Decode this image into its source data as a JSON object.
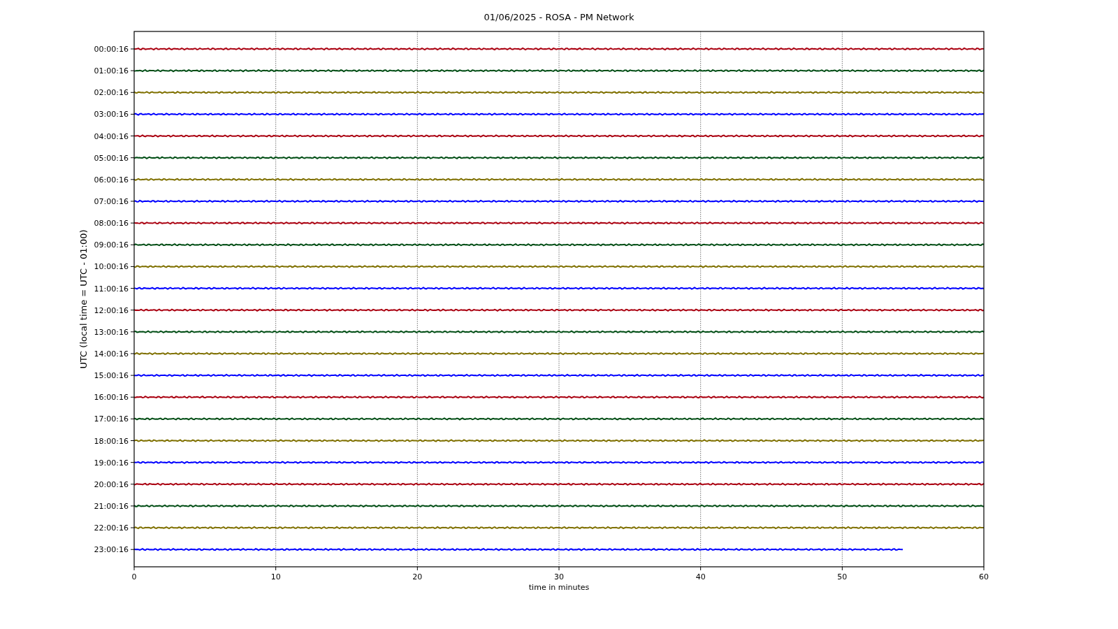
{
  "title": "01/06/2025 - ROSA - PM Network",
  "y_axis_label": "UTC (local time = UTC - 01:00)",
  "x_axis_label": "time in minutes",
  "x_ticks": [
    "0",
    "10",
    "20",
    "30",
    "40",
    "50",
    "60"
  ],
  "traces": [
    {
      "label": "00:00:16",
      "color": "#aa0010",
      "level": 1
    },
    {
      "label": "01:00:16",
      "color": "#004d14",
      "level": 1
    },
    {
      "label": "02:00:16",
      "color": "#7f7000",
      "level": 1
    },
    {
      "label": "03:00:16",
      "color": "#0000ff",
      "level": 1
    },
    {
      "label": "04:00:16",
      "color": "#aa0010",
      "level": 1
    },
    {
      "label": "05:00:16",
      "color": "#004d14",
      "level": 1
    },
    {
      "label": "06:00:16",
      "color": "#7f7000",
      "level": 1
    },
    {
      "label": "07:00:16",
      "color": "#0000ff",
      "level": 1
    },
    {
      "label": "08:00:16",
      "color": "#aa0010",
      "level": 1
    },
    {
      "label": "09:00:16",
      "color": "#004d14",
      "level": 1
    },
    {
      "label": "10:00:16",
      "color": "#7f7000",
      "level": 1
    },
    {
      "label": "11:00:16",
      "color": "#0000ff",
      "level": 1
    },
    {
      "label": "12:00:16",
      "color": "#aa0010",
      "level": 1
    },
    {
      "label": "13:00:16",
      "color": "#004d14",
      "level": 1
    },
    {
      "label": "14:00:16",
      "color": "#7f7000",
      "level": 1
    },
    {
      "label": "15:00:16",
      "color": "#0000ff",
      "level": 1
    },
    {
      "label": "16:00:16",
      "color": "#aa0010",
      "level": 1
    },
    {
      "label": "17:00:16",
      "color": "#004d14",
      "level": 1
    },
    {
      "label": "18:00:16",
      "color": "#7f7000",
      "level": 1
    },
    {
      "label": "19:00:16",
      "color": "#0000ff",
      "level": 1
    },
    {
      "label": "20:00:16",
      "color": "#aa0010",
      "level": 1
    },
    {
      "label": "21:00:16",
      "color": "#004d14",
      "level": 1
    },
    {
      "label": "22:00:16",
      "color": "#7f7000",
      "level": 1
    },
    {
      "label": "23:00:16",
      "color": "#0000ff",
      "level": 0.905
    }
  ]
}
